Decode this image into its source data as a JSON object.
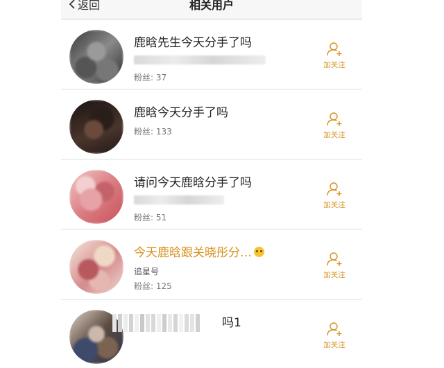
{
  "header": {
    "back_label": "返回",
    "title": "相关用户"
  },
  "follow_label": "加关注",
  "users": [
    {
      "name": "鹿晗先生今天分手了吗",
      "subtitle_redacted": true,
      "fans_label": "粉丝: 37"
    },
    {
      "name": "鹿晗今天分手了吗",
      "subtitle_redacted": false,
      "fans_label": "粉丝: 133"
    },
    {
      "name": "请问今天鹿晗分手了吗",
      "subtitle_redacted": true,
      "fans_label": "粉丝: 51"
    },
    {
      "name": "今天鹿晗跟关晓彤分…",
      "name_color": "#d7901b",
      "subtitle": "追星号",
      "fans_label": "粉丝: 125",
      "emoji": "astonished-face"
    },
    {
      "name_tail": "吗1",
      "name_redacted": true
    }
  ]
}
